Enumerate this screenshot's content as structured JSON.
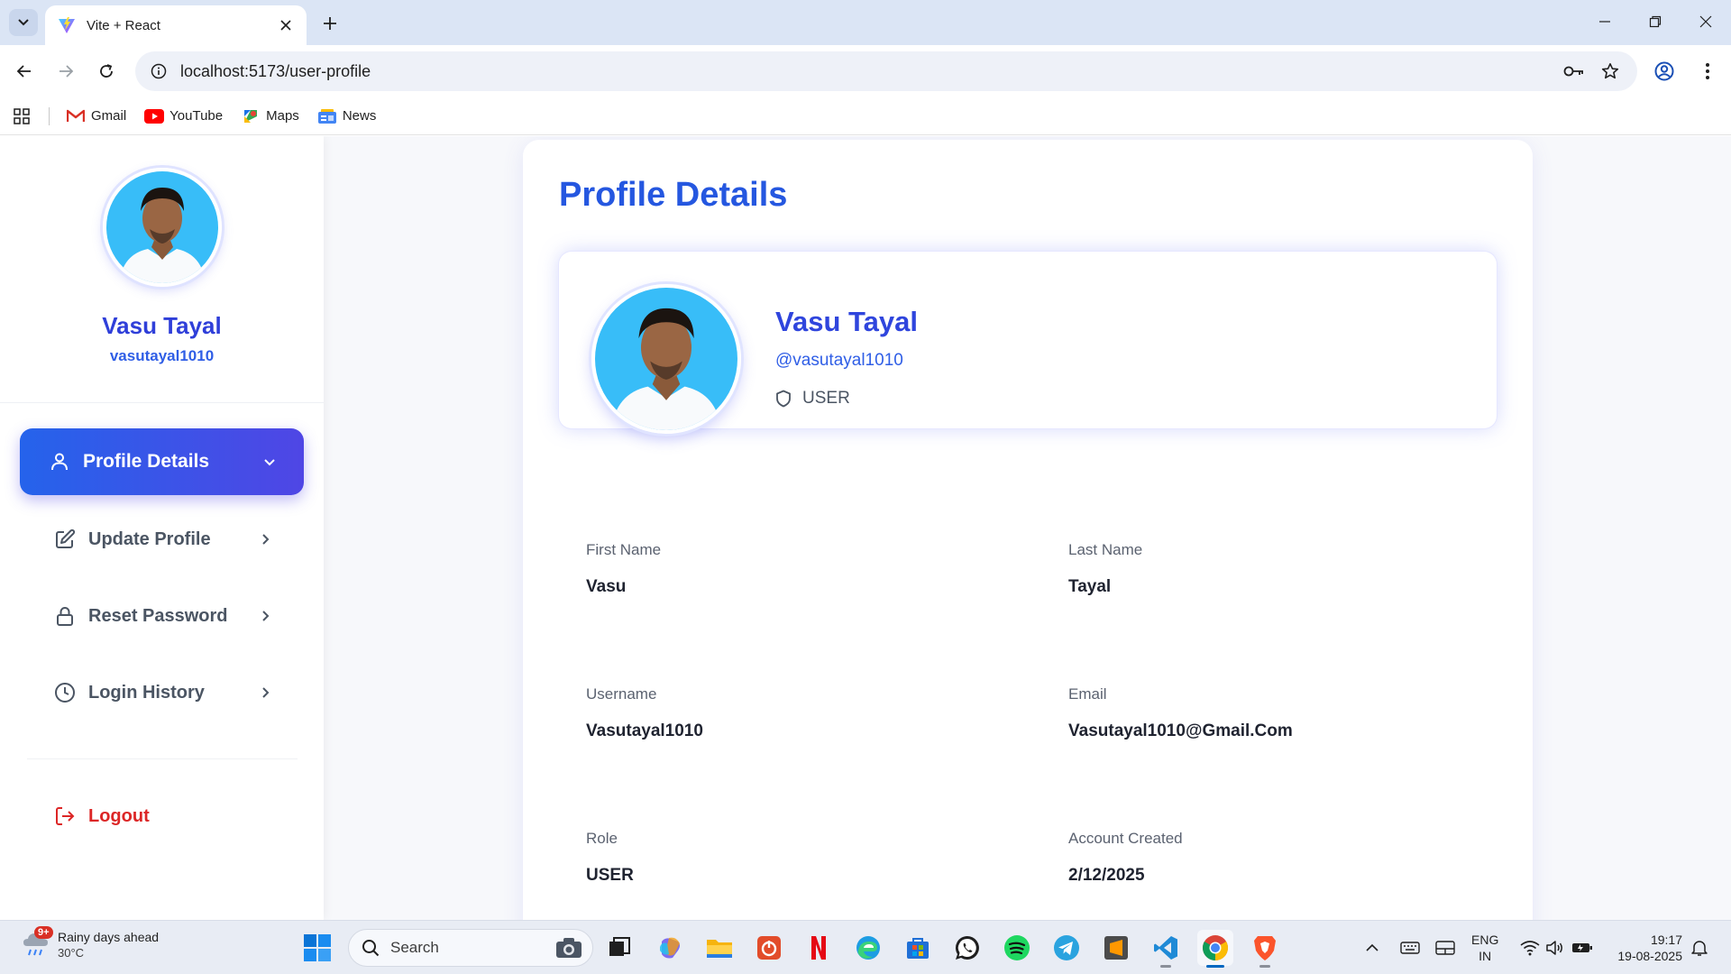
{
  "browser": {
    "tab_title": "Vite + React",
    "url": "localhost:5173/user-profile",
    "bookmarks": [
      "Gmail",
      "YouTube",
      "Maps",
      "News"
    ]
  },
  "sidebar": {
    "name": "Vasu Tayal",
    "username": "vasutayal1010",
    "nav": {
      "profile_details": "Profile Details",
      "update_profile": "Update Profile",
      "reset_password": "Reset Password",
      "login_history": "Login History"
    },
    "logout": "Logout"
  },
  "main": {
    "title": "Profile Details",
    "card": {
      "name": "Vasu Tayal",
      "username": "@vasutayal1010",
      "role": "USER"
    },
    "fields": {
      "first_name": {
        "label": "First Name",
        "value": "Vasu"
      },
      "last_name": {
        "label": "Last Name",
        "value": "Tayal"
      },
      "username": {
        "label": "Username",
        "value": "Vasutayal1010"
      },
      "email": {
        "label": "Email",
        "value": "Vasutayal1010@Gmail.Com"
      },
      "role": {
        "label": "Role",
        "value": "USER"
      },
      "account_created": {
        "label": "Account Created",
        "value": "2/12/2025"
      }
    }
  },
  "taskbar": {
    "weather_title": "Rainy days ahead",
    "weather_temp": "30°C",
    "weather_badge": "9+",
    "search_placeholder": "Search",
    "lang_line1": "ENG",
    "lang_line2": "IN",
    "time": "19:17",
    "date": "19-08-2025"
  },
  "colors": {
    "accent": "#2563eb",
    "accent_gradient_end": "#4f46e5",
    "logout": "#dc2626",
    "page_bg": "#f7f8fb"
  }
}
